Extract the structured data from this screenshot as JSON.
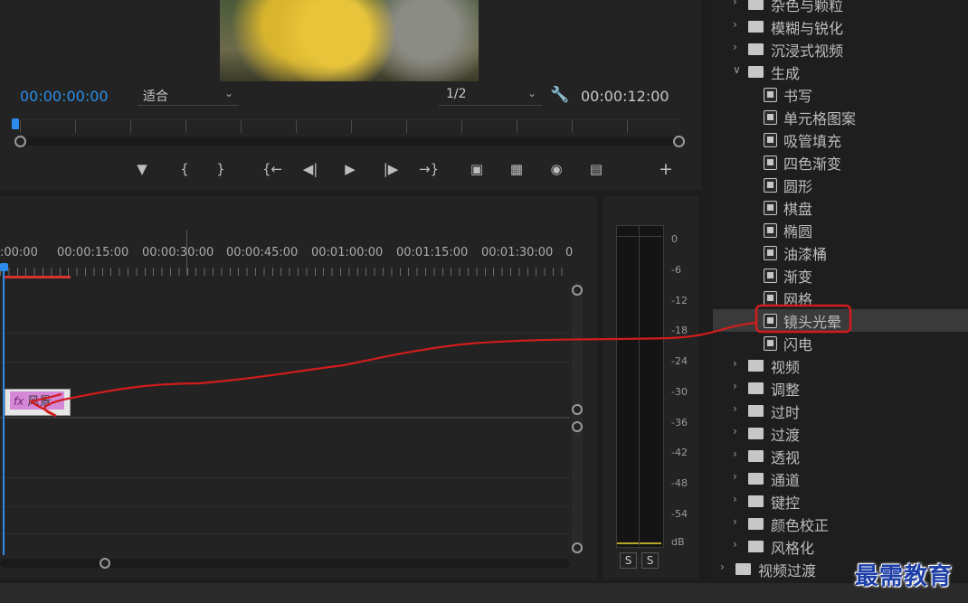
{
  "monitor": {
    "current_timecode": "00:00:00:00",
    "duration_timecode": "00:00:12:00",
    "zoom_value": "适合",
    "resolution_value": "1/2",
    "controls": [
      "marker-icon",
      "mark-in-icon",
      "mark-out-icon",
      "go-to-in-icon",
      "step-back-icon",
      "play-icon",
      "step-forward-icon",
      "go-to-out-icon",
      "lift-icon",
      "extract-icon",
      "export-frame-icon",
      "insert-icon",
      "add-button-icon"
    ]
  },
  "timeline": {
    "ruler_labels": [
      ":00:00",
      "00:00:15:00",
      "00:00:30:00",
      "00:00:45:00",
      "00:01:00:00",
      "00:01:15:00",
      "00:01:30:00",
      "0"
    ],
    "clip": {
      "fx": "fx",
      "name": "风景"
    }
  },
  "meter": {
    "db_labels": [
      "0",
      "-6",
      "-12",
      "-18",
      "-24",
      "-30",
      "-36",
      "-42",
      "-48",
      "-54",
      "dB"
    ],
    "solo": [
      "S",
      "S"
    ],
    "colors": {
      "level": "#b7a52a"
    }
  },
  "effects": {
    "rows": [
      {
        "type": "folder",
        "label": "杂色与颗粒",
        "expanded": false
      },
      {
        "type": "folder",
        "label": "模糊与锐化",
        "expanded": false
      },
      {
        "type": "folder",
        "label": "沉浸式视频",
        "expanded": false
      },
      {
        "type": "folder",
        "label": "生成",
        "expanded": true
      },
      {
        "type": "effect",
        "label": "书写"
      },
      {
        "type": "effect",
        "label": "单元格图案"
      },
      {
        "type": "effect",
        "label": "吸管填充"
      },
      {
        "type": "effect",
        "label": "四色渐变"
      },
      {
        "type": "effect",
        "label": "圆形"
      },
      {
        "type": "effect",
        "label": "棋盘"
      },
      {
        "type": "effect",
        "label": "椭圆"
      },
      {
        "type": "effect",
        "label": "油漆桶"
      },
      {
        "type": "effect",
        "label": "渐变"
      },
      {
        "type": "effect",
        "label": "网格"
      },
      {
        "type": "effect",
        "label": "镜头光晕",
        "selected": true
      },
      {
        "type": "effect",
        "label": "闪电"
      },
      {
        "type": "folder",
        "label": "视频",
        "expanded": false
      },
      {
        "type": "folder",
        "label": "调整",
        "expanded": false
      },
      {
        "type": "folder",
        "label": "过时",
        "expanded": false
      },
      {
        "type": "folder",
        "label": "过渡",
        "expanded": false
      },
      {
        "type": "folder",
        "label": "透视",
        "expanded": false
      },
      {
        "type": "folder",
        "label": "通道",
        "expanded": false
      },
      {
        "type": "folder",
        "label": "键控",
        "expanded": false
      },
      {
        "type": "folder",
        "label": "颜色校正",
        "expanded": false
      },
      {
        "type": "folder",
        "label": "风格化",
        "expanded": false
      },
      {
        "type": "folder",
        "label": "视频过渡",
        "expanded": false,
        "top_level": true
      }
    ]
  },
  "watermark": "最需教育",
  "colors": {
    "accent": "#2d8ceb",
    "annotation": "#d21c1c",
    "work_area": "#d9342b",
    "clip": "#d587d8"
  }
}
